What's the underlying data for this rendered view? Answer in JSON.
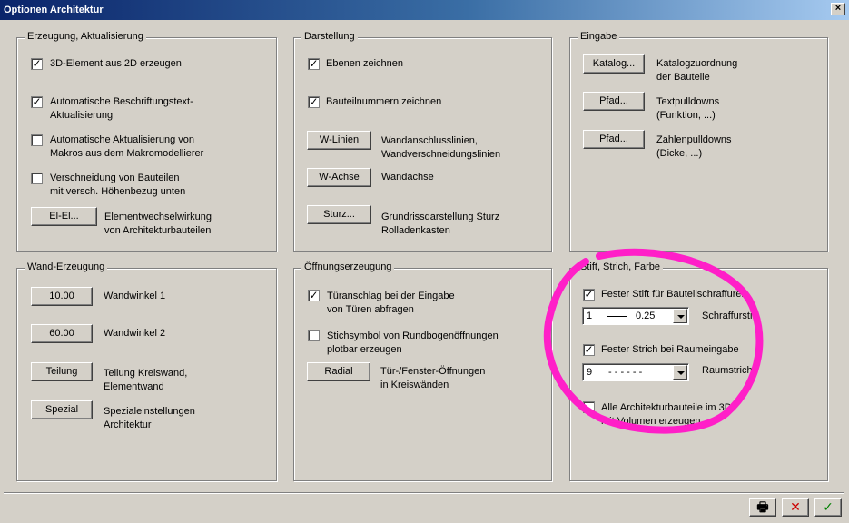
{
  "window": {
    "title": "Optionen Architektur",
    "close_glyph": "×"
  },
  "groups": {
    "erzeugung": {
      "title": "Erzeugung, Aktualisierung",
      "cb1": {
        "checked": true,
        "label": "3D-Element aus 2D erzeugen"
      },
      "cb2": {
        "checked": true,
        "label1": "Automatische Beschriftungstext-",
        "label2": "Aktualisierung"
      },
      "cb3": {
        "checked": false,
        "label1": "Automatische Aktualisierung von",
        "label2": "Makros aus dem Makromodellierer"
      },
      "cb4": {
        "checked": false,
        "label1": "Verschneidung von Bauteilen",
        "label2": "mit versch. Höhenbezug unten"
      },
      "btn": {
        "label": "El-El...",
        "desc1": "Elementwechselwirkung",
        "desc2": "von Architekturbauteilen"
      }
    },
    "darstellung": {
      "title": "Darstellung",
      "cb1": {
        "checked": true,
        "label": "Ebenen zeichnen"
      },
      "cb2": {
        "checked": true,
        "label": "Bauteilnummern zeichnen"
      },
      "btn1": {
        "label": "W-Linien",
        "desc1": "Wandanschlusslinien,",
        "desc2": "Wandverschneidungslinien"
      },
      "btn2": {
        "label": "W-Achse",
        "desc1": "Wandachse"
      },
      "btn3": {
        "label": "Sturz...",
        "desc1": "Grundrissdarstellung Sturz",
        "desc2": "Rolladenkasten"
      }
    },
    "eingabe": {
      "title": "Eingabe",
      "btn1": {
        "label": "Katalog...",
        "desc1": "Katalogzuordnung",
        "desc2": "der Bauteile"
      },
      "btn2": {
        "label": "Pfad...",
        "desc1": "Textpulldowns",
        "desc2": "(Funktion, ...)"
      },
      "btn3": {
        "label": "Pfad...",
        "desc1": "Zahlenpulldowns",
        "desc2": "(Dicke, ...)"
      }
    },
    "wand": {
      "title": "Wand-Erzeugung",
      "btn1": {
        "label": "10.00",
        "desc1": "Wandwinkel 1"
      },
      "btn2": {
        "label": "60.00",
        "desc1": "Wandwinkel 2"
      },
      "btn3": {
        "label": "Teilung",
        "desc1": "Teilung Kreiswand,",
        "desc2": "Elementwand"
      },
      "btn4": {
        "label": "Spezial",
        "desc1": "Spezialeinstellungen",
        "desc2": "Architektur"
      }
    },
    "oeffnung": {
      "title": "Öffnungserzeugung",
      "cb1": {
        "checked": true,
        "label1": "Türanschlag bei der Eingabe",
        "label2": "von Türen abfragen"
      },
      "cb2": {
        "checked": false,
        "label1": "Stichsymbol von Rundbogenöffnungen",
        "label2": "plotbar erzeugen"
      },
      "btn": {
        "label": "Radial",
        "desc1": "Tür-/Fenster-Öffnungen",
        "desc2": "in Kreiswänden"
      }
    },
    "stift": {
      "title": "Stift, Strich, Farbe",
      "cb1": {
        "checked": true,
        "label": "Fester Stift für Bauteilschraffuren"
      },
      "combo1": {
        "num": "1",
        "value": "0.25",
        "label": "Schraffurstift"
      },
      "cb2": {
        "checked": true,
        "label": "Fester Strich bei Raumeingabe"
      },
      "combo2": {
        "num": "9",
        "pattern": "- - - - - -",
        "label": "Raumstrich"
      },
      "cb3": {
        "checked": false,
        "label1": "Alle Architekturbauteile im 3D",
        "label2": "mit Volumen erzeugen"
      }
    }
  },
  "footer": {
    "print_glyph": "🖶",
    "cancel_glyph": "✕",
    "ok_glyph": "✓",
    "cancel_color": "#cc0000",
    "ok_color": "#008000"
  },
  "annotation_color": "#ff1fc8"
}
